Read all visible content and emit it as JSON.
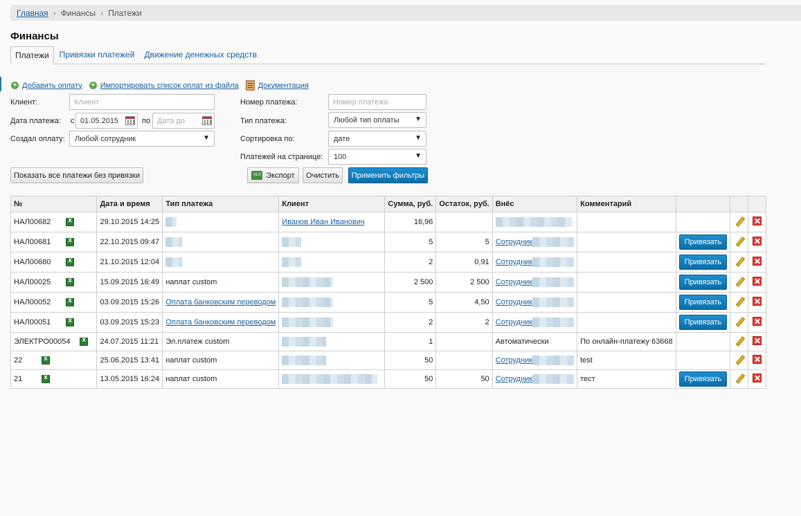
{
  "breadcrumb": {
    "home": "Главная",
    "section": "Финансы",
    "current": "Платежи"
  },
  "page_title": "Финансы",
  "tabs": [
    "Платежи",
    "Привязки платежей",
    "Движение денежных средств"
  ],
  "actions": {
    "add": "Добавить оплату",
    "import": "Импортировать список оплат из файла",
    "docs": "Документация"
  },
  "filters": {
    "client_label": "Клиент:",
    "client_placeholder": "Клиент",
    "date_label": "Дата платежа:",
    "date_from_prefix": "с",
    "date_from_value": "01.05.2015",
    "date_to_prefix": "по",
    "date_to_placeholder": "Дата до",
    "creator_label": "Создал оплату:",
    "creator_value": "Любой сотрудник",
    "number_label": "Номер платежа:",
    "number_placeholder": "Номер платежа",
    "type_label": "Тип платежа:",
    "type_value": "Любой тип оплаты",
    "sort_label": "Сортировка по:",
    "sort_value": "дате",
    "per_page_label": "Платежей на странице:",
    "per_page_value": "100"
  },
  "buttons": {
    "show_unbound": "Показать все платежи без привязки",
    "export": "Экспорт",
    "clear": "Очистить",
    "apply": "Применить фильтры",
    "bind": "Привязать"
  },
  "table": {
    "headers": [
      "№",
      "Дата и время",
      "Тип платежа",
      "Клиент",
      "Сумма, руб.",
      "Остаток, руб.",
      "Внёс",
      "Комментарий"
    ],
    "rows": [
      {
        "id": "НАЛ00682",
        "datetime": "29.10.2015 14:25",
        "type": "",
        "type_link": false,
        "client": "Иванов Иван Иванович",
        "sum": "16,96",
        "rest": "",
        "payer": "",
        "comment": "",
        "bind": false
      },
      {
        "id": "НАЛ00681",
        "datetime": "22.10.2015 09:47",
        "type": "",
        "type_link": false,
        "client": "",
        "sum": "5",
        "rest": "5",
        "payer": "Сотрудник",
        "comment": "",
        "bind": true
      },
      {
        "id": "НАЛ00680",
        "datetime": "21.10.2015 12:04",
        "type": "",
        "type_link": false,
        "client": "",
        "sum": "2",
        "rest": "0,91",
        "payer": "Сотрудник",
        "comment": "",
        "bind": true
      },
      {
        "id": "НАЛ00025",
        "datetime": "15.09.2015 16:49",
        "type": "наплат custom",
        "type_link": false,
        "client": "",
        "sum": "2 500",
        "rest": "2 500",
        "payer": "Сотрудник",
        "comment": "",
        "bind": true
      },
      {
        "id": "НАЛ00052",
        "datetime": "03.09.2015 15:26",
        "type": "Оплата банковским переводом",
        "type_link": true,
        "client": "",
        "sum": "5",
        "rest": "4,50",
        "payer": "Сотрудник",
        "comment": "",
        "bind": true
      },
      {
        "id": "НАЛ00051",
        "datetime": "03.09.2015 15:23",
        "type": "Оплата банковским переводом",
        "type_link": true,
        "client": "",
        "sum": "2",
        "rest": "2",
        "payer": "Сотрудник",
        "comment": "",
        "bind": true
      },
      {
        "id": "ЭЛЕКТРО00054",
        "datetime": "24.07.2015 11:21",
        "type": "Эл.платеж custom",
        "type_link": false,
        "client": "",
        "sum": "1",
        "rest": "",
        "payer": "Автоматически",
        "comment": "По онлайн-платежу 63668",
        "bind": false
      },
      {
        "id": "22",
        "datetime": "25.06.2015 13:41",
        "type": "наплат custom",
        "type_link": false,
        "client": "",
        "sum": "50",
        "rest": "",
        "payer": "Сотрудник",
        "comment": "test",
        "bind": false
      },
      {
        "id": "21",
        "datetime": "13.05.2015 16:24",
        "type": "наплат custom",
        "type_link": false,
        "client": "",
        "sum": "50",
        "rest": "50",
        "payer": "Сотрудник",
        "comment": "тест",
        "bind": true
      }
    ]
  }
}
